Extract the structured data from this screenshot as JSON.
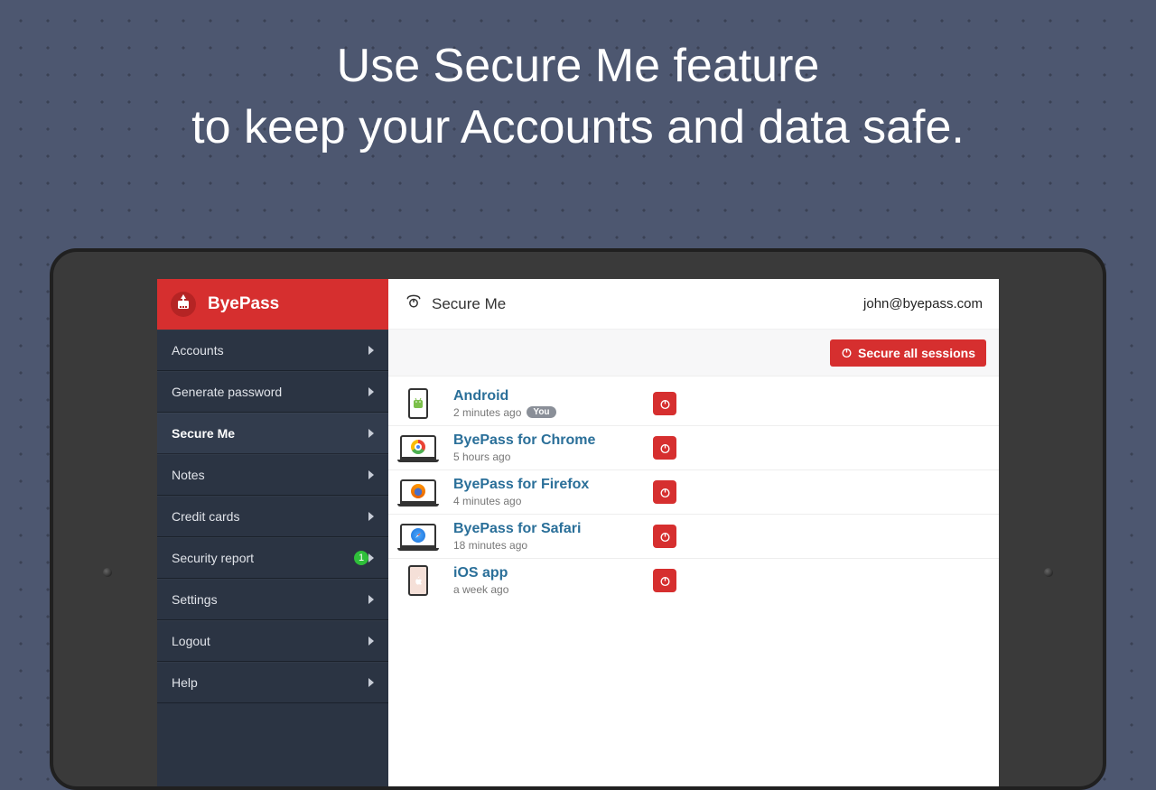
{
  "hero": {
    "line1": "Use Secure Me feature",
    "line2": "to keep your Accounts and data safe."
  },
  "brand": {
    "name": "ByePass"
  },
  "sidebar": {
    "items": [
      {
        "label": "Accounts",
        "id": "accounts"
      },
      {
        "label": "Generate password",
        "id": "generate-password"
      },
      {
        "label": "Secure Me",
        "id": "secure-me",
        "active": true
      },
      {
        "label": "Notes",
        "id": "notes"
      },
      {
        "label": "Credit cards",
        "id": "credit-cards"
      },
      {
        "label": "Security report",
        "id": "security-report",
        "badge": "1"
      },
      {
        "label": "Settings",
        "id": "settings"
      },
      {
        "label": "Logout",
        "id": "logout"
      },
      {
        "label": "Help",
        "id": "help"
      }
    ]
  },
  "header": {
    "title": "Secure Me",
    "email": "john@byepass.com"
  },
  "actions": {
    "secureAll": "Secure all sessions"
  },
  "sessions": [
    {
      "name": "Android",
      "meta": "2 minutes ago",
      "you": "You",
      "device": "phone-android"
    },
    {
      "name": "ByePass for Chrome",
      "meta": "5 hours ago",
      "device": "laptop-chrome"
    },
    {
      "name": "ByePass for Firefox",
      "meta": "4 minutes ago",
      "device": "laptop-firefox"
    },
    {
      "name": "ByePass for Safari",
      "meta": "18 minutes ago",
      "device": "laptop-safari"
    },
    {
      "name": "iOS app",
      "meta": "a week ago",
      "device": "phone-ios"
    }
  ]
}
